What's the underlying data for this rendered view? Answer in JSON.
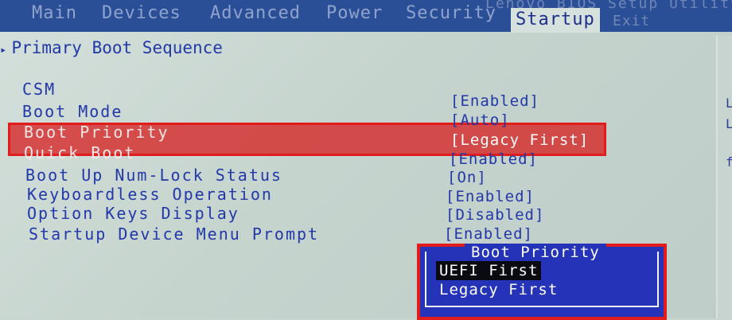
{
  "app": {
    "title": "Lenovo BIOS Setup Utility"
  },
  "tabs": [
    {
      "label": "Main"
    },
    {
      "label": "Devices"
    },
    {
      "label": "Advanced"
    },
    {
      "label": "Power"
    },
    {
      "label": "Security"
    },
    {
      "label": "Startup"
    },
    {
      "label": "Exit"
    }
  ],
  "active_tab": "Startup",
  "section": {
    "title": "Primary Boot Sequence"
  },
  "settings": [
    {
      "label": "CSM",
      "value": "[Enabled]"
    },
    {
      "label": "Boot Mode",
      "value": "[Auto]"
    },
    {
      "label": "Boot Priority",
      "value": "[Legacy First]"
    },
    {
      "label": "Quick Boot",
      "value": "[Enabled]"
    },
    {
      "label": "Boot Up Num-Lock Status",
      "value": "[On]"
    },
    {
      "label": "Keyboardless Operation",
      "value": "[Enabled]"
    },
    {
      "label": "Option Keys Display",
      "value": "[Disabled]"
    },
    {
      "label": "Startup Device Menu Prompt",
      "value": "[Enabled]"
    }
  ],
  "popup": {
    "title": "Boot Priority",
    "options": [
      {
        "label": "UEFI First",
        "selected": true
      },
      {
        "label": "Legacy First",
        "selected": false
      }
    ]
  },
  "right_edge_chars": [
    "L",
    "L",
    "f"
  ],
  "colors": {
    "background": "#c9d6cf",
    "topbar": "#2b4f97",
    "text": "#2238a8",
    "highlight": "#e01c1c",
    "popup": "#2433b8"
  }
}
